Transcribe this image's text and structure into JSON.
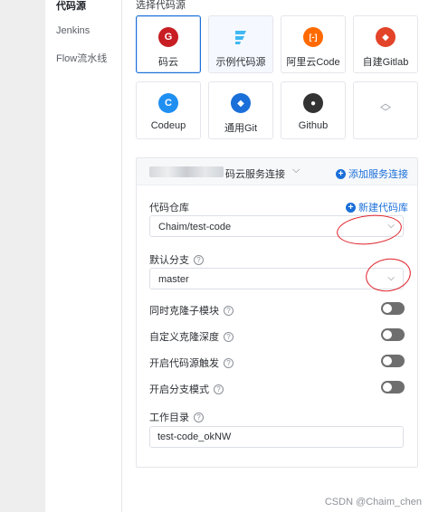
{
  "nav": {
    "items": [
      {
        "label": "代码源",
        "active": true
      },
      {
        "label": "Jenkins",
        "active": false
      },
      {
        "label": "Flow流水线",
        "active": false
      }
    ]
  },
  "source": {
    "section_label": "选择代码源",
    "cards": [
      {
        "label": "码云",
        "icon": "gitee-icon",
        "glyph": "G",
        "color": "#c71d23",
        "selected": true
      },
      {
        "label": "示例代码源",
        "icon": "example-code-icon",
        "glyph": "",
        "color": "#41b8f3",
        "selected": false
      },
      {
        "label": "阿里云Code",
        "icon": "aliyun-code-icon",
        "glyph": "[-]",
        "color": "#ff6a00",
        "selected": false
      },
      {
        "label": "自建Gitlab",
        "icon": "gitlab-icon",
        "glyph": "◆",
        "color": "#e24329",
        "selected": false
      },
      {
        "label": "Codeup",
        "icon": "codeup-icon",
        "glyph": "C",
        "color": "#1f8ff2",
        "selected": false
      },
      {
        "label": "通用Git",
        "icon": "git-icon",
        "glyph": "◆",
        "color": "#1a6fd9",
        "selected": false
      },
      {
        "label": "Github",
        "icon": "github-icon",
        "glyph": "●",
        "color": "#333333",
        "selected": false
      }
    ],
    "expand_icon": "chevron-updown-icon"
  },
  "connection": {
    "name": "码云服务连接",
    "add_label": "添加服务连接"
  },
  "repo": {
    "label": "代码仓库",
    "new_label": "新建代码库",
    "value": "Chaim/test-code"
  },
  "branch": {
    "label": "默认分支",
    "value": "master"
  },
  "toggles": [
    {
      "label": "同时克隆子模块",
      "on": false
    },
    {
      "label": "自定义克隆深度",
      "on": false
    },
    {
      "label": "开启代码源触发",
      "on": false
    },
    {
      "label": "开启分支模式",
      "on": false
    }
  ],
  "workdir": {
    "label": "工作目录",
    "value": "test-code_okNW"
  },
  "watermark": "CSDN @Chaim_chen",
  "colors": {
    "accent": "#1a6fd9",
    "annotation": "#e0212a",
    "toggle_off": "#6e6e6e"
  }
}
